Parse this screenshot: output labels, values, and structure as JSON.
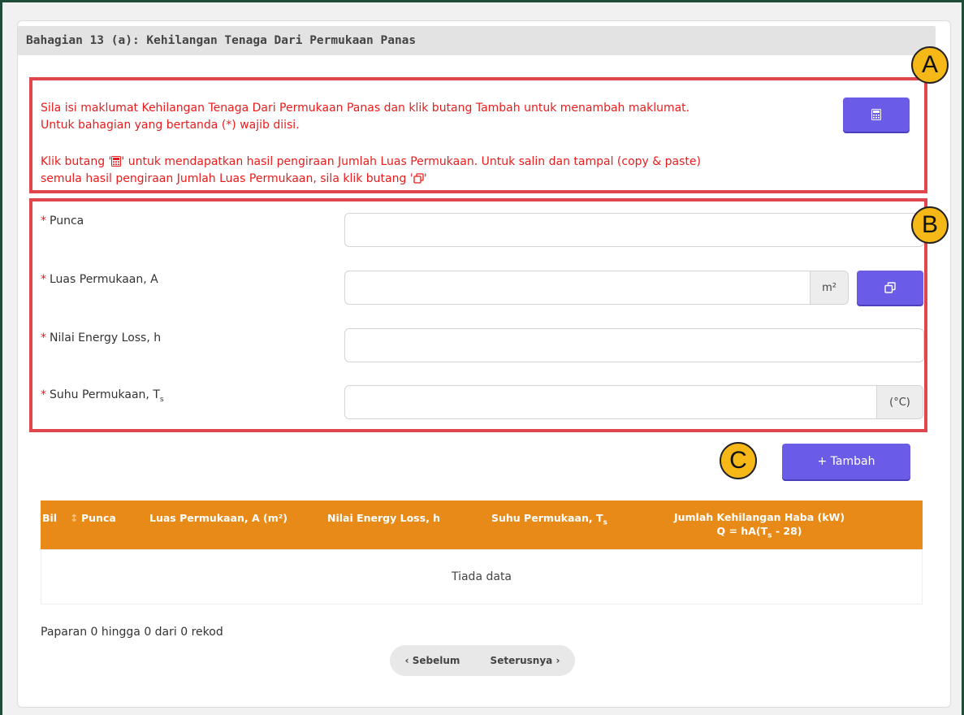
{
  "section": {
    "title": "Bahagian 13 (a): Kehilangan Tenaga Dari Permukaan Panas"
  },
  "notes": {
    "line1": "Sila isi maklumat Kehilangan Tenaga Dari Permukaan Panas dan klik butang Tambah untuk menambah maklumat.",
    "line2": "Untuk bahagian yang bertanda (*) wajib diisi.",
    "line3a": "Klik butang '",
    "line3b": "' untuk mendapatkan hasil pengiraan Jumlah Luas Permukaan. Untuk salin dan tampal (copy & paste)",
    "line4a": "semula hasil pengiraan Jumlah Luas Permukaan, sila klik butang '",
    "line4b": "'"
  },
  "badges": {
    "a": "A",
    "b": "B",
    "c": "C"
  },
  "form": {
    "required_mark": "*",
    "punca_label": "Punca",
    "punca_value": "",
    "luas_label": "Luas Permukaan, A",
    "luas_value": "",
    "luas_unit": "m²",
    "nilai_label": "Nilai Energy Loss, h",
    "nilai_value": "",
    "suhu_label": "Suhu Permukaan, T",
    "suhu_sub": "s",
    "suhu_value": "",
    "suhu_unit": "(°C)"
  },
  "buttons": {
    "tambah_label": "+ Tambah"
  },
  "table": {
    "col_bil": "Bil",
    "col_punca": "Punca",
    "col_luas": "Luas Permukaan, A (m²)",
    "col_nilai": "Nilai Energy Loss, h",
    "col_suhu": "Suhu Permukaan, T",
    "col_suhu_sub": "s",
    "col_jumlah": "Jumlah Kehilangan Haba (kW)",
    "col_formula_a": "Q = hA(T",
    "col_formula_sub": "s",
    "col_formula_b": " - 28)",
    "empty": "Tiada data"
  },
  "pagination": {
    "info": "Paparan 0 hingga 0 dari 0 rekod",
    "prev": "‹ Sebelum",
    "next": "Seterusnya ›"
  },
  "colors": {
    "accent": "#6b5ce7",
    "header_orange": "#e88a17",
    "annotation_red": "#e0474c",
    "required_red": "#e81c1c",
    "badge_yellow": "#f6b817"
  }
}
